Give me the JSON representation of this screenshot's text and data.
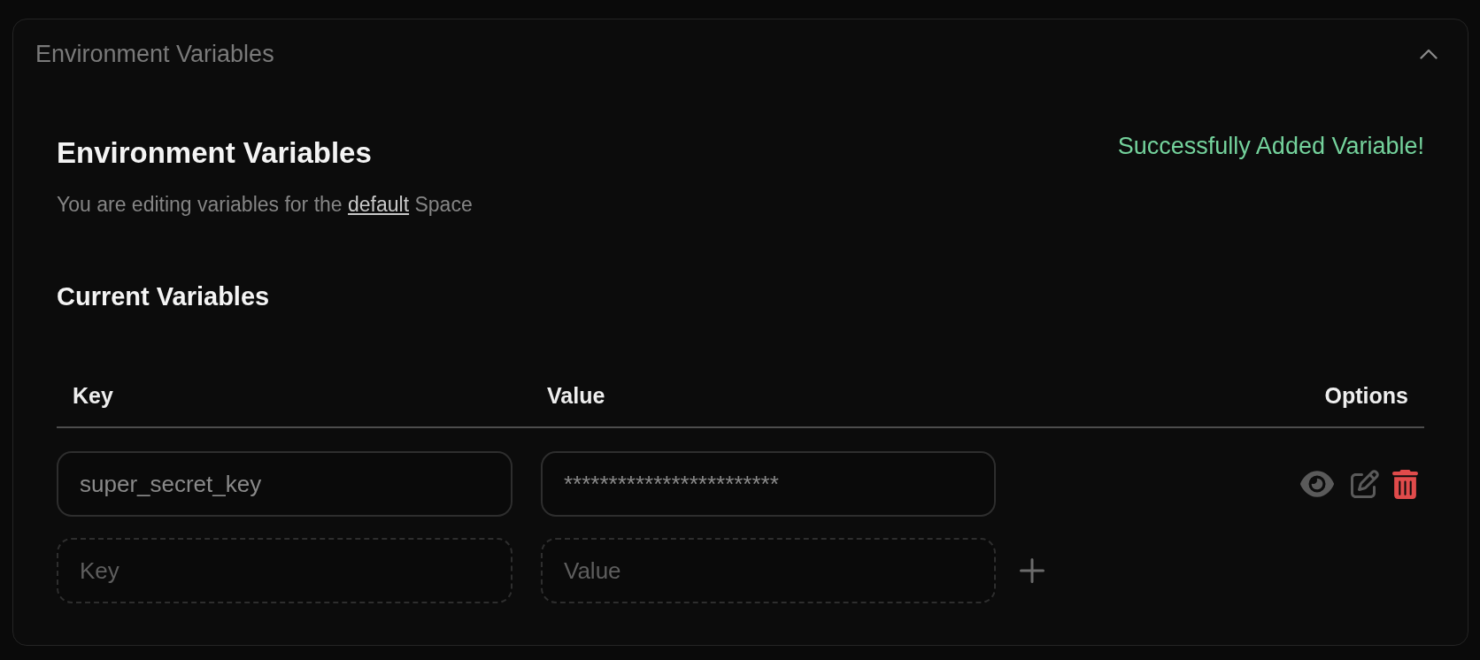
{
  "panel": {
    "title": "Environment Variables",
    "expanded": true
  },
  "header": {
    "title": "Environment Variables",
    "note": {
      "before": "You are editing variables for the",
      "link": "default",
      "after": "Space"
    },
    "status_message": "Successfully Added Variable!"
  },
  "current_variables": {
    "title": "Current Variables",
    "columns": [
      "Key",
      "Value",
      "Options"
    ],
    "rows": [
      {
        "key": "super_secret_key",
        "value": "************************"
      }
    ],
    "new_row": {
      "key_placeholder": "Key",
      "value_placeholder": "Value"
    }
  }
}
